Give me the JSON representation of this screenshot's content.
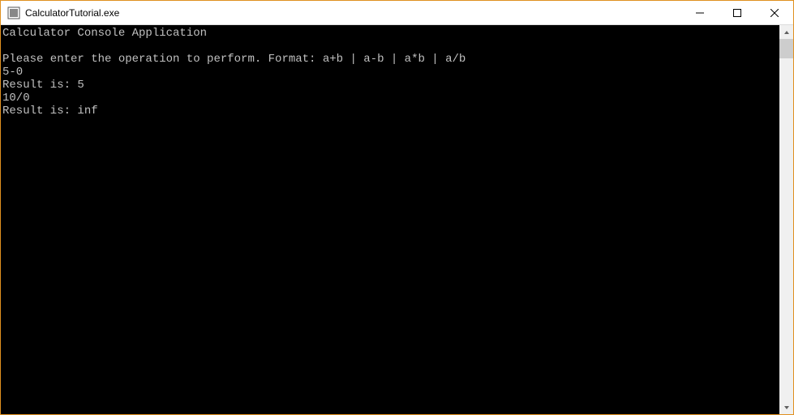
{
  "window": {
    "title": "CalculatorTutorial.exe"
  },
  "console": {
    "lines": [
      "Calculator Console Application",
      "",
      "Please enter the operation to perform. Format: a+b | a-b | a*b | a/b",
      "5-0",
      "Result is: 5",
      "10/0",
      "Result is: inf"
    ]
  }
}
